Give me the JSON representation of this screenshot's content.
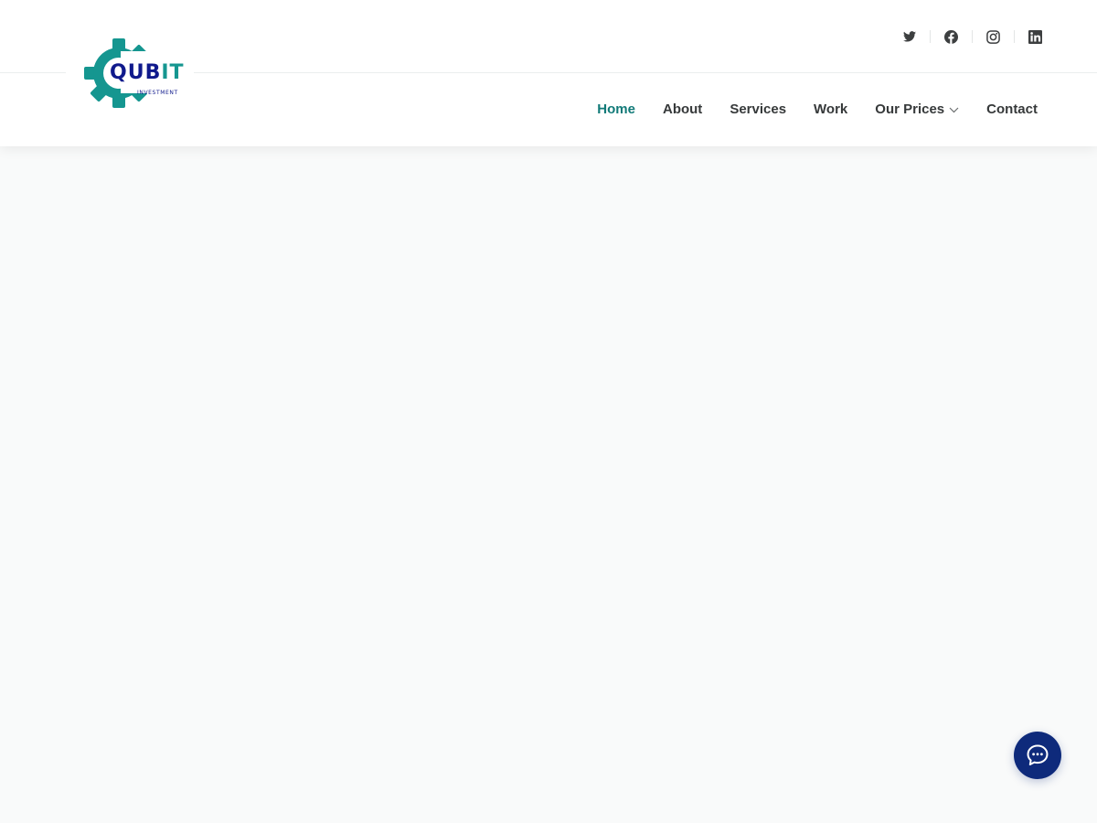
{
  "brand": {
    "name_part1": "QUB",
    "name_part2": "IT",
    "tagline": "INVESTMENT",
    "colors": {
      "gear": "#159690",
      "wordmark": "#101a8c",
      "accent": "#159690"
    }
  },
  "social": [
    {
      "name": "twitter",
      "icon": "twitter-icon"
    },
    {
      "name": "facebook",
      "icon": "facebook-icon"
    },
    {
      "name": "instagram",
      "icon": "instagram-icon"
    },
    {
      "name": "linkedin",
      "icon": "linkedin-icon"
    }
  ],
  "nav": {
    "items": [
      {
        "label": "Home",
        "active": true
      },
      {
        "label": "About",
        "active": false
      },
      {
        "label": "Services",
        "active": false
      },
      {
        "label": "Work",
        "active": false
      },
      {
        "label": "Our Prices",
        "active": false,
        "dropdown": true
      },
      {
        "label": "Contact",
        "active": false
      }
    ],
    "colors": {
      "active": "#117a78",
      "default": "#36393a"
    }
  },
  "chat": {
    "icon": "chat-bubble-icon",
    "color": "#0e2a7b"
  }
}
